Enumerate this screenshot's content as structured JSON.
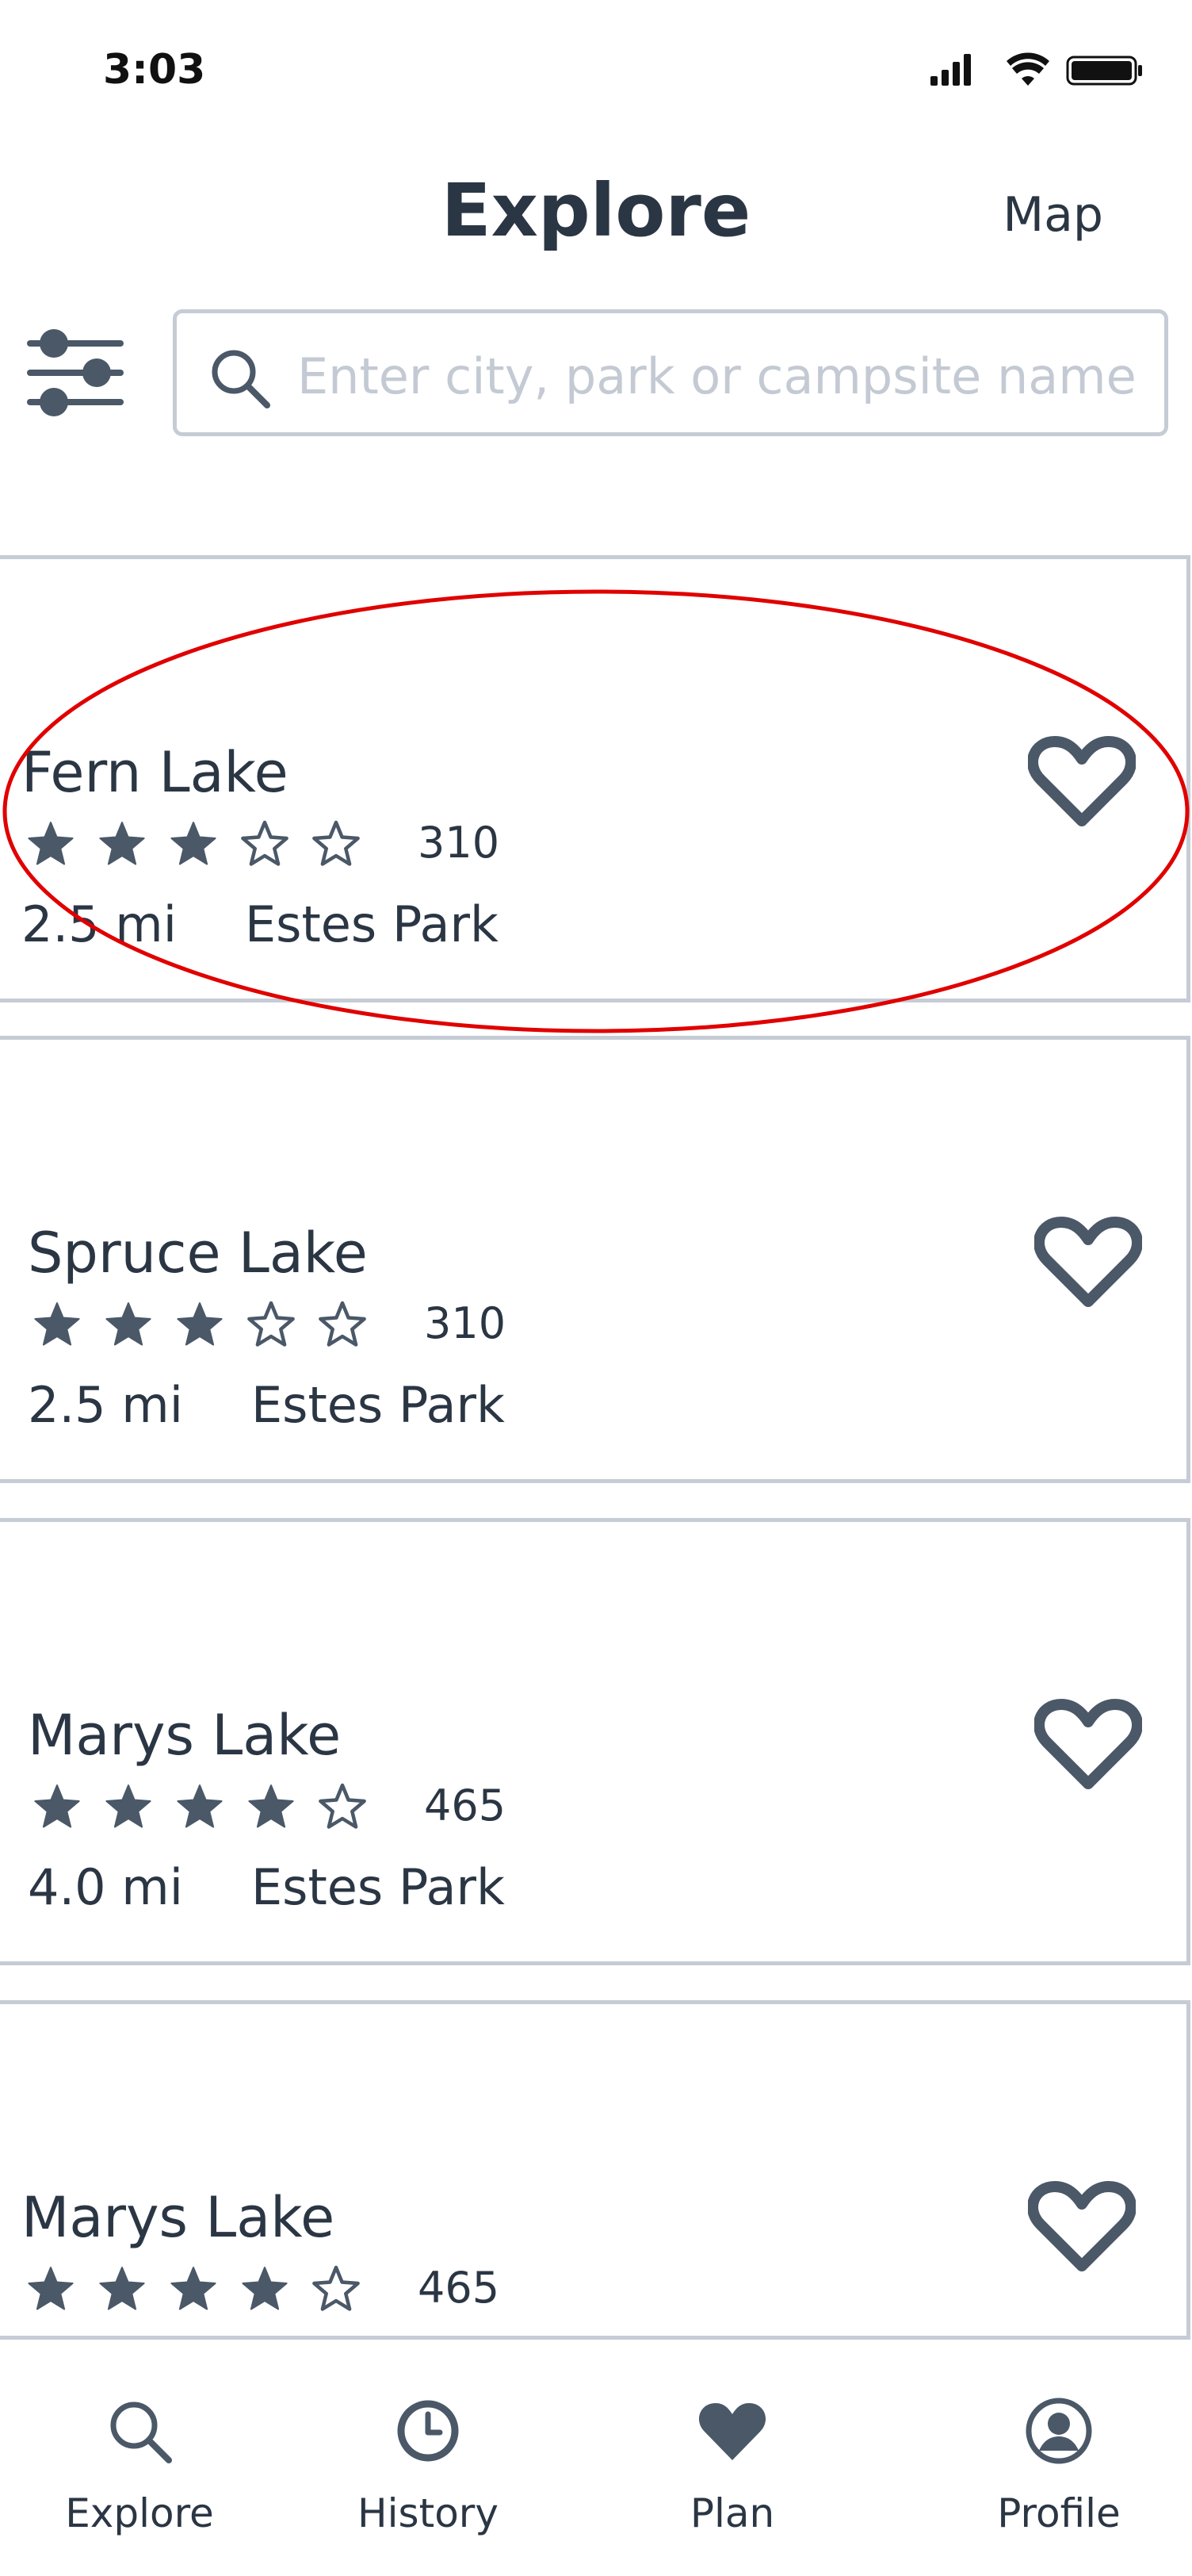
{
  "status_bar": {
    "time": "3:03",
    "icons": [
      "signal-icon",
      "wifi-icon",
      "battery-icon"
    ]
  },
  "header": {
    "title": "Explore",
    "map_label": "Map"
  },
  "search": {
    "placeholder": "Enter city, park or campsite name",
    "value": ""
  },
  "colors": {
    "accent": "#4a5868",
    "border": "#c6ccd5",
    "placeholder": "#c4cad3",
    "highlight": "#e00000"
  },
  "campsites": [
    {
      "name": "Fern Lake",
      "rating": 3,
      "max_rating": 5,
      "reviews": "310",
      "distance": "2.5 mi",
      "location": "Estes Park",
      "favorite": false,
      "highlighted": true
    },
    {
      "name": "Spruce Lake",
      "rating": 3,
      "max_rating": 5,
      "reviews": "310",
      "distance": "2.5 mi",
      "location": "Estes Park",
      "favorite": false,
      "highlighted": false
    },
    {
      "name": "Marys Lake",
      "rating": 4,
      "max_rating": 5,
      "reviews": "465",
      "distance": "4.0 mi",
      "location": "Estes Park",
      "favorite": false,
      "highlighted": false
    },
    {
      "name": "Marys Lake",
      "rating": 4,
      "max_rating": 5,
      "reviews": "465",
      "distance": "",
      "location": "",
      "favorite": false,
      "highlighted": false
    }
  ],
  "tabs": [
    {
      "label": "Explore",
      "icon": "search-icon"
    },
    {
      "label": "History",
      "icon": "clock-icon"
    },
    {
      "label": "Plan",
      "icon": "heart-filled-icon"
    },
    {
      "label": "Profile",
      "icon": "user-circle-icon"
    }
  ]
}
